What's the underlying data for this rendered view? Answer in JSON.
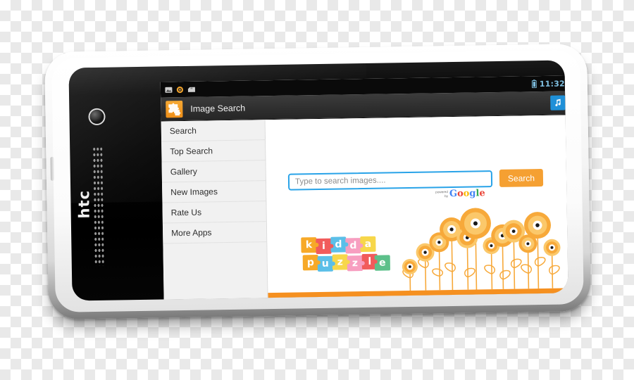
{
  "device": {
    "brand_logo": "htc",
    "nav_buttons": [
      {
        "name": "recents",
        "icon": "recents-icon"
      },
      {
        "name": "back",
        "icon": "back-icon"
      },
      {
        "name": "hide",
        "icon": "chevron-down-icon"
      }
    ]
  },
  "statusbar": {
    "notification_icons": [
      "screenshot-icon",
      "download-icon",
      "sd-card-icon"
    ],
    "battery_icon": "battery-icon",
    "clock": "11:32"
  },
  "actionbar": {
    "app_icon": "puzzle-app-icon",
    "title": "Image Search",
    "music_icon": "music-note-icon"
  },
  "drawer": {
    "items": [
      {
        "label": "Search"
      },
      {
        "label": "Top Search"
      },
      {
        "label": "Gallery"
      },
      {
        "label": "New Images"
      },
      {
        "label": "Rate Us"
      },
      {
        "label": "More Apps"
      }
    ]
  },
  "search": {
    "placeholder": "Type to search images....",
    "value": "",
    "button_label": "Search",
    "powered_by_line1": "powered",
    "powered_by_line2": "by",
    "brand_letters": [
      {
        "ch": "G",
        "color": "#4285F4"
      },
      {
        "ch": "o",
        "color": "#EA4335"
      },
      {
        "ch": "o",
        "color": "#FBBC05"
      },
      {
        "ch": "g",
        "color": "#4285F4"
      },
      {
        "ch": "l",
        "color": "#34A853"
      },
      {
        "ch": "e",
        "color": "#EA4335"
      }
    ]
  },
  "artwork": {
    "logo_name": "kidda-puzzle-logo",
    "logo_row1": [
      {
        "ch": "k",
        "color": "#f7a928"
      },
      {
        "ch": "i",
        "color": "#f15b5b"
      },
      {
        "ch": "d",
        "color": "#5bbfe8"
      },
      {
        "ch": "d",
        "color": "#f79ec0"
      },
      {
        "ch": "a",
        "color": "#f7d74a"
      }
    ],
    "logo_row2": [
      {
        "ch": "p",
        "color": "#f7a928"
      },
      {
        "ch": "u",
        "color": "#5bbfe8"
      },
      {
        "ch": "z",
        "color": "#f7d74a"
      },
      {
        "ch": "z",
        "color": "#f79ec0"
      },
      {
        "ch": "l",
        "color": "#f15b5b"
      },
      {
        "ch": "e",
        "color": "#5cc08a"
      }
    ],
    "flowers_name": "sunflower-illustration",
    "band_color": "#f59020",
    "flower_color": "#f7a93a",
    "flower_color_light": "#fbc86a"
  },
  "colors": {
    "accent_orange": "#f5a032",
    "input_border_blue": "#29a3e8",
    "music_blue": "#1f90d8",
    "clock_blue": "#7fbfe0",
    "drawer_bg": "#f1f1f1",
    "actionbar_bg": "#2f2f2f"
  }
}
